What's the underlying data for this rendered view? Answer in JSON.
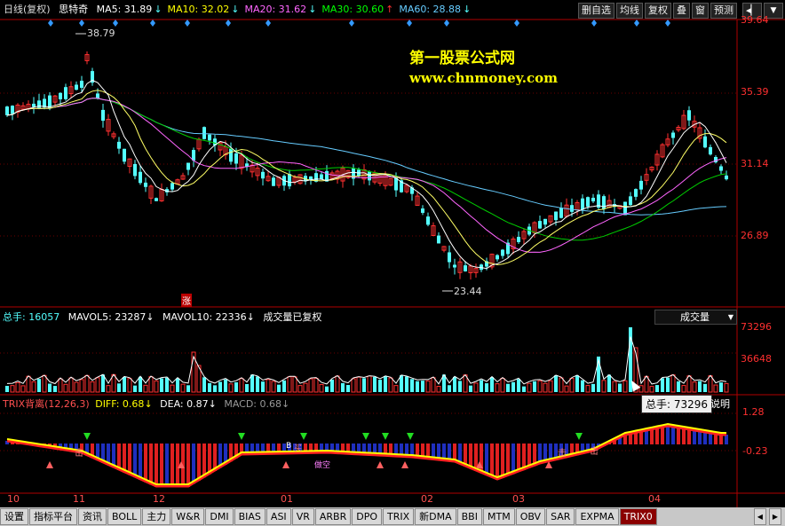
{
  "header": {
    "period": "日线(复权)",
    "stock": "思特奇",
    "ma": [
      {
        "label": "MA5: 31.89",
        "color": "#ffffff",
        "arrow": "down"
      },
      {
        "label": "MA10: 32.02",
        "color": "#ffff00",
        "arrow": "down"
      },
      {
        "label": "MA20: 31.62",
        "color": "#ff66ff",
        "arrow": "down"
      },
      {
        "label": "MA30: 30.60",
        "color": "#00ff00",
        "arrow": "up"
      },
      {
        "label": "MA60: 28.88",
        "color": "#66ccff",
        "arrow": "down"
      }
    ],
    "buttons": [
      "删自选",
      "均线",
      "复权",
      "叠",
      "窗",
      "预测"
    ]
  },
  "price_axis": [
    "39.64",
    "35.39",
    "31.14",
    "26.89"
  ],
  "watermark": {
    "line1": "第一股票公式网",
    "line2": "www.chnmoney.com"
  },
  "price_marks": {
    "high": "38.79",
    "low": "23.44",
    "zhang": "涨"
  },
  "volume": {
    "total": "总手: 16057",
    "mavol5": "MAVOL5: 23287",
    "mavol10": "MAVOL10: 22336",
    "note": "成交量已复权",
    "dropdown": "成交量",
    "axis_top": "73296",
    "axis_mid": "36648",
    "tooltip": "总手: 73296"
  },
  "trix": {
    "title": "TRIX背离(12,26,3)",
    "diff": "DIFF: 0.68",
    "dea": "DEA: 0.87",
    "macd": "MACD: 0.68",
    "axis_top": "1.28",
    "axis_bottom": "-0.23",
    "explain": "说明",
    "labels": [
      "击",
      "击",
      "B",
      "买",
      "做空",
      "击"
    ]
  },
  "date_axis": [
    "10",
    "11",
    "12",
    "01",
    "02",
    "03",
    "04"
  ],
  "tabs": [
    "设置",
    "指标平台",
    "资讯",
    "BOLL",
    "主力",
    "W&R",
    "DMI",
    "BIAS",
    "ASI",
    "VR",
    "ARBR",
    "DPO",
    "TRIX",
    "新DMA",
    "BBI",
    "MTM",
    "OBV",
    "SAR",
    "EXPMA",
    "TRIX0"
  ],
  "active_tab": "TRIX0",
  "colors": {
    "up": "#ff3030",
    "down": "#54ffff",
    "axis": "#b00000",
    "yellow": "#ffff00"
  }
}
